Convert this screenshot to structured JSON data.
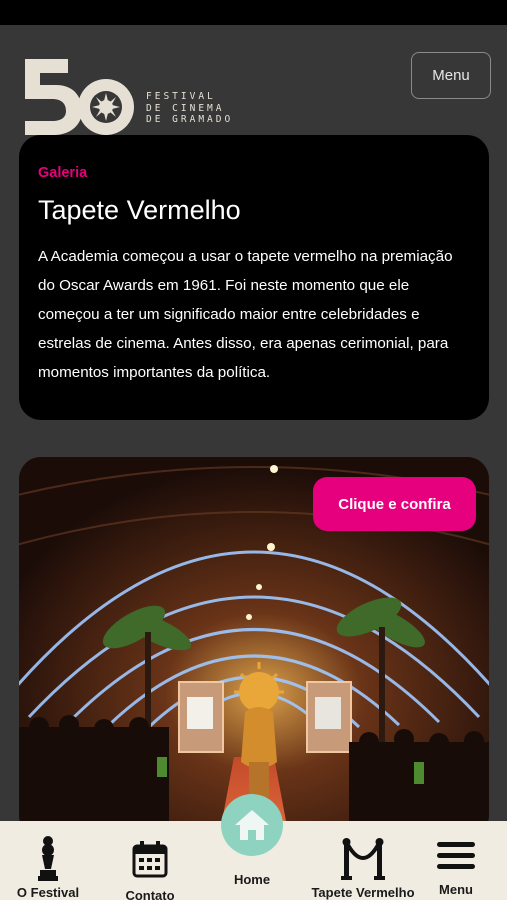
{
  "header": {
    "logo_text": [
      "FESTIVAL",
      "DE CINEMA",
      "DE GRAMADO"
    ],
    "menu_label": "Menu"
  },
  "card": {
    "category": "Galeria",
    "title": "Tapete Vermelho",
    "body": "A Academia começou a usar o tapete vermelho na premiação do Oscar Awards em 1961. Foi neste momento que ele começou a ter um significado maior entre celebridades e estrelas de cinema. Antes disso, era apenas cerimonial, para momentos importantes da política."
  },
  "gallery": {
    "cta_label": "Clique e confira"
  },
  "bottom_nav": {
    "items": [
      {
        "label": "O Festival",
        "icon": "trophy-icon"
      },
      {
        "label": "Contato",
        "icon": "calendar-icon"
      },
      {
        "label": "Home",
        "icon": "home-icon"
      },
      {
        "label": "Tapete Vermelho",
        "icon": "stanchion-icon"
      },
      {
        "label": "Menu",
        "icon": "hamburger-icon"
      }
    ]
  },
  "colors": {
    "background": "#373737",
    "accent": "#e6007e",
    "card": "#000000",
    "nav_background": "#f1ece2",
    "home_circle": "#8ed3c0"
  }
}
